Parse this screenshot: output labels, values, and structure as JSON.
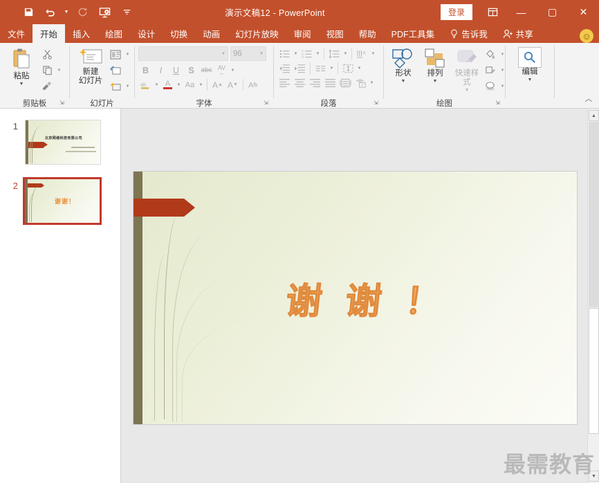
{
  "titlebar": {
    "document_title": "演示文稿12  -  PowerPoint",
    "signin_label": "登录",
    "quick_access": [
      {
        "name": "save-icon",
        "label": "保存",
        "enabled": true
      },
      {
        "name": "undo-icon",
        "label": "撤消",
        "enabled": true
      },
      {
        "name": "redo-icon",
        "label": "恢复",
        "enabled": false
      },
      {
        "name": "start-slideshow-icon",
        "label": "从头开始",
        "enabled": true
      },
      {
        "name": "customize-quick-access-icon",
        "label": "自定义快速访问工具栏",
        "enabled": true
      }
    ],
    "window_buttons": {
      "ribbon_display": "▣",
      "minimize": "—",
      "maximize": "▢",
      "close": "✕"
    }
  },
  "tabs": [
    {
      "label": "文件",
      "active": false
    },
    {
      "label": "开始",
      "active": true
    },
    {
      "label": "插入",
      "active": false
    },
    {
      "label": "绘图",
      "active": false
    },
    {
      "label": "设计",
      "active": false
    },
    {
      "label": "切换",
      "active": false
    },
    {
      "label": "动画",
      "active": false
    },
    {
      "label": "幻灯片放映",
      "active": false
    },
    {
      "label": "审阅",
      "active": false
    },
    {
      "label": "视图",
      "active": false
    },
    {
      "label": "帮助",
      "active": false
    },
    {
      "label": "PDF工具集",
      "active": false
    },
    {
      "label": "告诉我",
      "active": false
    },
    {
      "label": "共享",
      "active": false
    }
  ],
  "ribbon": {
    "groups": {
      "clipboard": {
        "label": "剪贴板",
        "paste_label": "粘贴",
        "cut_label": "剪切",
        "copy_label": "复制",
        "format_painter_label": "格式刷"
      },
      "slides": {
        "label": "幻灯片",
        "new_slide_label": "新建\n幻灯片",
        "new_slide_line1": "新建",
        "new_slide_line2": "幻灯片",
        "layout_label": "版式",
        "reset_label": "重置",
        "section_label": "节"
      },
      "font": {
        "label": "字体",
        "font_name_value": "",
        "font_name_placeholder": "",
        "font_size_value": "96",
        "bold": "B",
        "italic": "I",
        "underline": "U",
        "shadow": "S",
        "strikethrough": "abc",
        "char_spacing": "AV",
        "text_highlight": "ab",
        "font_color": "A",
        "change_case": "Aa",
        "increase_size": "A",
        "decrease_size": "A",
        "clear_formatting": "A"
      },
      "paragraph": {
        "label": "段落",
        "bullets_label": "项目符号",
        "numbering_label": "编号",
        "line_spacing_label": "行距",
        "text_direction_label": "文字方向",
        "decrease_indent_label": "减少缩进量",
        "increase_indent_label": "增加缩进量",
        "align_left_label": "左对齐",
        "align_center_label": "居中",
        "align_right_label": "右对齐",
        "justify_label": "两端对齐",
        "columns_label": "分栏",
        "align_text_label": "对齐文本",
        "smartart_label": "转换为 SmartArt"
      },
      "drawing": {
        "label": "绘图",
        "shapes_label": "形状",
        "arrange_label": "排列",
        "quick_styles_label": "快速样式",
        "shape_fill_label": "形状填充",
        "shape_outline_label": "形状轮廓",
        "shape_effects_label": "形状效果"
      },
      "editing": {
        "label": "编辑",
        "edit_label": "编辑"
      }
    },
    "collapse_label": "折叠功能区"
  },
  "slide_panel": {
    "slides": [
      {
        "number": "1",
        "selected": false,
        "title_text": "北京网络科技有限公司"
      },
      {
        "number": "2",
        "selected": true,
        "title_text": "谢谢！"
      }
    ]
  },
  "main_slide": {
    "content_text": "谢 谢 ！"
  },
  "scrollbar": {
    "up_arrow": "▲",
    "down_arrow": "▼"
  },
  "watermark": {
    "text": "最需教育"
  },
  "colors": {
    "brand_red": "#c3502c",
    "accent_arrow": "#b03a1a",
    "slide_bar": "#7d7553",
    "thanks_text": "#f2a965",
    "selection_border": "#c0392b"
  }
}
